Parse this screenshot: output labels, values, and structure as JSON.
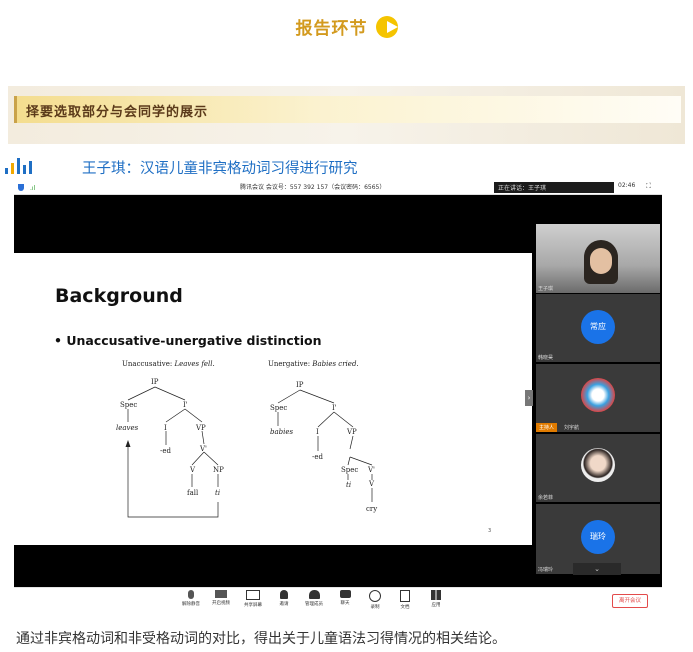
{
  "header": {
    "title": "报告环节"
  },
  "banner": {
    "text": "择要选取部分与会同学的展示"
  },
  "section": {
    "title": "王子琪：汉语儿童非宾格动词习得进行研究"
  },
  "meeting": {
    "info": "腾讯会议 会议号：557 392 157（会议密码：6565）",
    "speaking": "正在讲话：王子琪",
    "time": "02:46",
    "participants": [
      {
        "name": "王子琪",
        "avatar": ""
      },
      {
        "name": "韩晓昊",
        "avatar": "常应"
      },
      {
        "name": "刘宇航",
        "avatar": "",
        "badge": "主持人"
      },
      {
        "name": "余若菲",
        "avatar": ""
      },
      {
        "name": "冯瑞玲",
        "avatar": "瑞玲"
      }
    ],
    "toolbar": [
      "解除静音",
      "开启视频",
      "共享屏幕",
      "邀请",
      "管理成员",
      "聊天",
      "录制",
      "文档",
      "应用"
    ],
    "end_label": "离开会议"
  },
  "slide": {
    "title": "Background",
    "bullet": "Unaccusative-unergative distinction",
    "page": "3",
    "tree_left": {
      "caption_a": "Unaccusative: ",
      "caption_b": "Leaves fell.",
      "nodes": [
        "IP",
        "Spec",
        "I'",
        "leaves",
        "I",
        "VP",
        "-ed",
        "V'",
        "V",
        "NP",
        "fall",
        "ti"
      ]
    },
    "tree_right": {
      "caption_a": "Unergative: ",
      "caption_b": "Babies cried.",
      "nodes": [
        "IP",
        "Spec",
        "I'",
        "babies",
        "I",
        "VP",
        "-ed",
        "Spec",
        "V'",
        "ti",
        "V",
        "cry"
      ]
    }
  },
  "caption": "通过非宾格动词和非受格动词的对比，得出关于儿童语法习得情况的相关结论。",
  "colors": {
    "accent_gold": "#d39a1e",
    "link_blue": "#1f6fc4",
    "zoom_blue": "#1a73e8"
  }
}
